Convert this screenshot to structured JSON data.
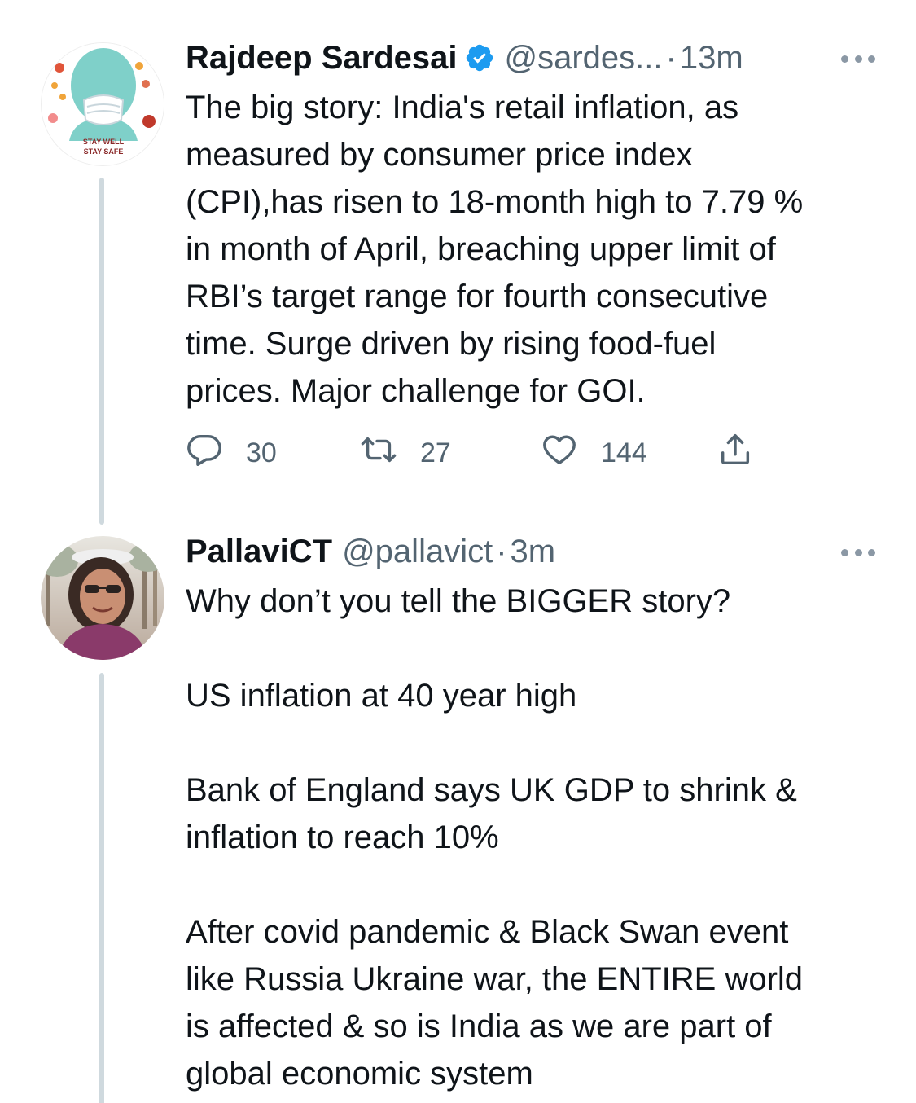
{
  "tweets": [
    {
      "author": {
        "name": "Rajdeep Sardesai",
        "handle": "@sardes...",
        "verified": true,
        "avatar_caption_1": "STAY WELL",
        "avatar_caption_2": "STAY SAFE"
      },
      "separator": "·",
      "time": "13m",
      "text": "The big story: India's retail inflation, as\nmeasured by consumer price index\n(CPI),has risen to 18-month high to 7.79 %\nin month of April, breaching  upper limit of\nRBI’s target range for  fourth consecutive\ntime. Surge driven by rising food-fuel\nprices. Major challenge for GOI.",
      "stats": {
        "replies": "30",
        "retweets": "27",
        "likes": "144"
      },
      "icons": [
        "reply-icon",
        "retweet-icon",
        "like-icon",
        "share-icon",
        "verified-badge-icon",
        "more-options-icon"
      ]
    },
    {
      "author": {
        "name": "PallaviCT",
        "handle": "@pallavict",
        "verified": false
      },
      "separator": "·",
      "time": "3m",
      "text": "Why don’t you tell the BIGGER story?\n\nUS inflation at 40 year high\n\nBank of England says UK GDP to shrink &\ninflation to reach 10%\n\nAfter covid pandemic & Black Swan event\nlike Russia Ukraine war, the ENTIRE world\nis affected & so is India as we are part of\nglobal economic system"
    }
  ],
  "colors": {
    "text": "#0f1419",
    "secondary": "#536471",
    "verified": "#1d9bf0",
    "thread_line": "#cfd9de"
  }
}
